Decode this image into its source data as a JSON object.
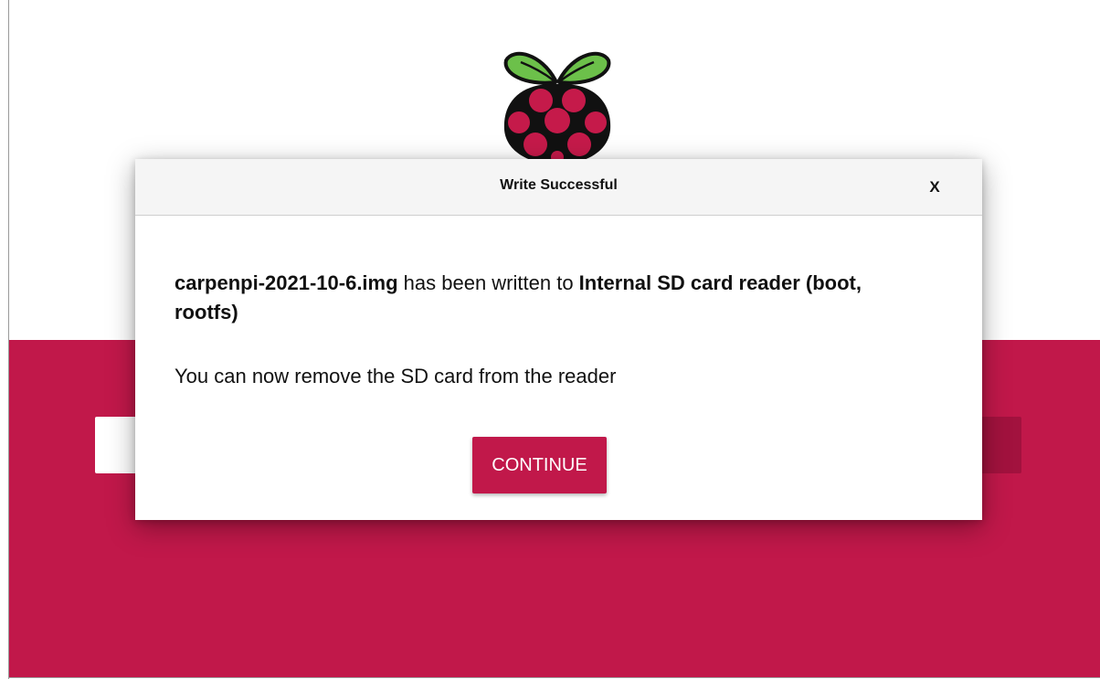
{
  "dialog": {
    "title": "Write Successful",
    "close_label": "X",
    "message": {
      "filename": "carpenpi-2021-10-6.img",
      "middle_text": " has been written to ",
      "target": "Internal SD card reader (boot, rootfs)"
    },
    "sub_message": "You can now remove the SD card from the reader",
    "continue_label": "CONTINUE"
  },
  "colors": {
    "accent": "#c1184a",
    "accent_dark": "#a2123e",
    "leaf_green": "#6cc04a",
    "berry": "#c51a4a"
  },
  "icons": {
    "logo": "raspberry-pi-logo",
    "close": "close-icon"
  }
}
